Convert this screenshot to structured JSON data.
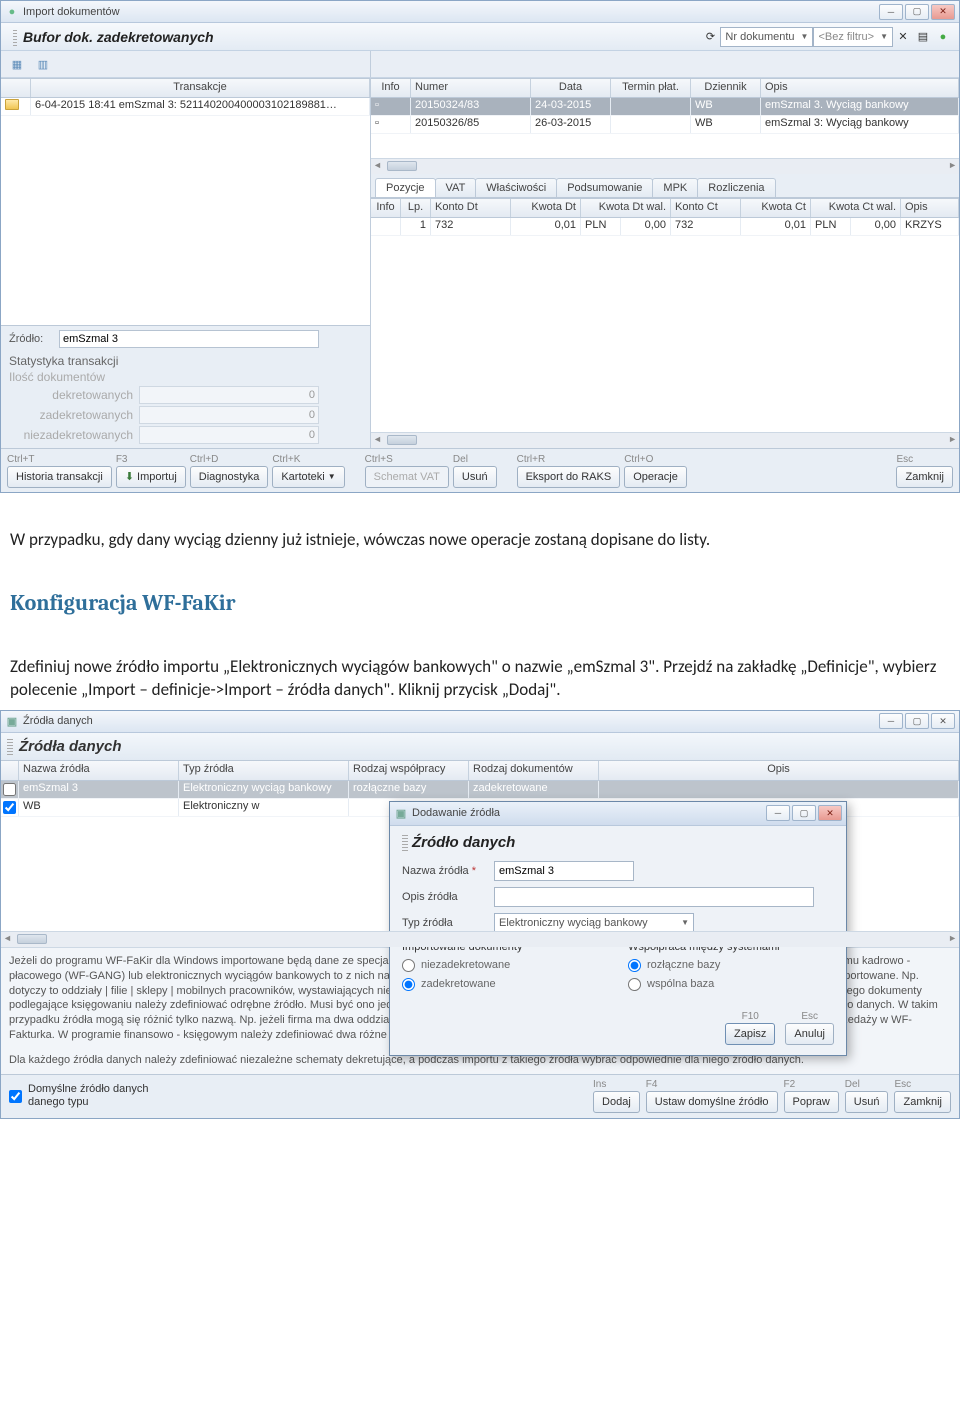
{
  "window1": {
    "title": "Import dokumentów",
    "panel_title": "Bufor dok. zadekretowanych",
    "filter_combo1": "Nr dokumentu",
    "filter_combo2": "<Bez filtru>",
    "left_grid": {
      "header": "Transakcje",
      "row1": "6-04-2015 18:41 emSzmal 3: 521140200400003102189881…"
    },
    "right_grid": {
      "headers": [
        "Info",
        "Numer",
        "Data",
        "Termin płat.",
        "Dziennik",
        "Opis"
      ],
      "row1": {
        "numer": "20150324/83",
        "data": "24-03-2015",
        "termin": "",
        "dziennik": "WB",
        "opis": "emSzmal 3. Wyciąg bankowy"
      },
      "row2": {
        "numer": "20150326/85",
        "data": "26-03-2015",
        "termin": "",
        "dziennik": "WB",
        "opis": "emSzmal 3: Wyciąg bankowy"
      }
    },
    "tabs": [
      "Pozycje",
      "VAT",
      "Właściwości",
      "Podsumowanie",
      "MPK",
      "Rozliczenia"
    ],
    "detail_headers": [
      "Info",
      "Lp.",
      "Konto Dt",
      "Kwota Dt",
      "Kwota Dt wal.",
      "Konto Ct",
      "Kwota Ct",
      "Kwota Ct wal.",
      "Opis"
    ],
    "detail_row": {
      "lp": "1",
      "kontodt": "732",
      "kwotadt": "0,01",
      "kwotadtwal_cur": "PLN",
      "kwotadtwal": "0,00",
      "kontoct": "732",
      "kwotact": "0,01",
      "kwotactwal_cur": "PLN",
      "kwotactwal": "0,00",
      "opis": "KRZYS"
    },
    "source_label": "Źródło:",
    "source_value": "emSzmal 3",
    "stats": {
      "title": "Statystyka transakcji",
      "subtitle": "Ilość dokumentów",
      "rows": [
        {
          "label": "dekretowanych",
          "value": "0"
        },
        {
          "label": "zadekretowanych",
          "value": "0"
        },
        {
          "label": "niezadekretowanych",
          "value": "0"
        }
      ]
    },
    "footer_buttons": {
      "historia": {
        "sc": "Ctrl+T",
        "label": "Historia transakcji"
      },
      "importuj": {
        "sc": "F3",
        "label": "Importuj"
      },
      "diagnostyka": {
        "sc": "Ctrl+D",
        "label": "Diagnostyka"
      },
      "kartoteki": {
        "sc": "Ctrl+K",
        "label": "Kartoteki"
      },
      "schemat": {
        "sc": "Ctrl+S",
        "label": "Schemat VAT"
      },
      "usun": {
        "sc": "Del",
        "label": "Usuń"
      },
      "eksport": {
        "sc": "Ctrl+R",
        "label": "Eksport do RAKS"
      },
      "operacje": {
        "sc": "Ctrl+O",
        "label": "Operacje"
      },
      "zamknij": {
        "sc": "Esc",
        "label": "Zamknij"
      }
    }
  },
  "para1": " W przypadku, gdy dany wyciąg dzienny już istnieje, wówczas nowe operacje zostaną dopisane do listy.",
  "heading": "Konfiguracja WF-FaKir",
  "para2": "Zdefiniuj nowe źródło importu „Elektronicznych wyciągów bankowych\" o nazwie „emSzmal 3\". Przejdź na zakładkę „Definicje\", wybierz polecenie „Import – definicje->Import – źródła danych\". Kliknij przycisk „Dodaj\".",
  "window2": {
    "title": "Źródła danych",
    "panel_title": "Źródła danych",
    "headers": [
      "Nazwa źródła",
      "Typ źródła",
      "Rodzaj współpracy",
      "Rodzaj dokumentów",
      "Opis"
    ],
    "row1": {
      "nazwa": "emSzmal 3",
      "typ": "Elektroniczny wyciąg bankowy",
      "wsp": "rozłączne bazy",
      "rodzaj": "zadekretowane",
      "opis": ""
    },
    "row2": {
      "nazwa": "WB",
      "typ": "Elektroniczny w",
      "wsp": "",
      "rodzaj": "",
      "opis": ""
    },
    "info_text": "Jeżeli do programu WF-FaKir dla Windows importowane będą dane ze specjalizowanego programu firmy Asseco WAPRO (WF-Mag dla Windows lub WF-Fakturka), programu kadrowo - płacowego (WF-GANG) lub elektronicznych wyciągów bankowych to z nich należy zdefiniować niezależne źródło danych. Źródło danych definiuje skąd i jakie dane będą importowane. Np. dotyczy to oddziały | filie | sklepy | mobilnych pracowników, wystawiających niezależnie dokumenty sprzedaży lub dokumenty magazynowe. Dla każdego źródła wystawiającego dokumenty podlegające księgowaniu należy zdefiniować odrębne źródło. Musi być ono jednoznaczne, nawet jeżeli każde z nich dysponuje takim samym programem stanowiącym źródło danych. W takim przypadku źródła mogą się różnić tylko nazwą. Np. jeżeli firma ma dwa oddziały korzystające z dwóch różnych baz WF-Fakturki wystawiających niezależnie dokumenty sprzedaży w WF-Fakturka. W programie finansowo - księgowym należy zdefiniować dwa różne źródła.",
    "info_text2": "Dla każdego źródła danych należy zdefiniować niezależne schematy dekretujące, a podczas importu z takiego źródła wybrać odpowiednie dla niego źródło danych.",
    "footer_checkbox": "Domyślne źródło danych danego typu",
    "footer_buttons": {
      "dodaj": {
        "sc": "Ins",
        "label": "Dodaj"
      },
      "ustaw": {
        "sc": "F4",
        "label": "Ustaw domyślne źródło"
      },
      "popraw": {
        "sc": "F2",
        "label": "Popraw"
      },
      "usun": {
        "sc": "Del",
        "label": "Usuń"
      },
      "zamknij": {
        "sc": "Esc",
        "label": "Zamknij"
      }
    }
  },
  "dialog": {
    "title": "Dodawanie źródła",
    "heading": "Źródło danych",
    "fields": {
      "nazwa_label": "Nazwa źródła",
      "nazwa_value": "emSzmal 3",
      "opis_label": "Opis źródła",
      "opis_value": "",
      "typ_label": "Typ źródła",
      "typ_value": "Elektroniczny wyciąg bankowy"
    },
    "group1": {
      "title": "Importowane dokumenty",
      "opt1": "niezadekretowane",
      "opt2": "zadekretowane"
    },
    "group2": {
      "title": "Współpraca między systemami",
      "opt1": "rozłączne bazy",
      "opt2": "wspólna baza"
    },
    "buttons": {
      "zapisz": {
        "sc": "F10",
        "label": "Zapisz"
      },
      "anuluj": {
        "sc": "Esc",
        "label": "Anuluj"
      }
    }
  }
}
